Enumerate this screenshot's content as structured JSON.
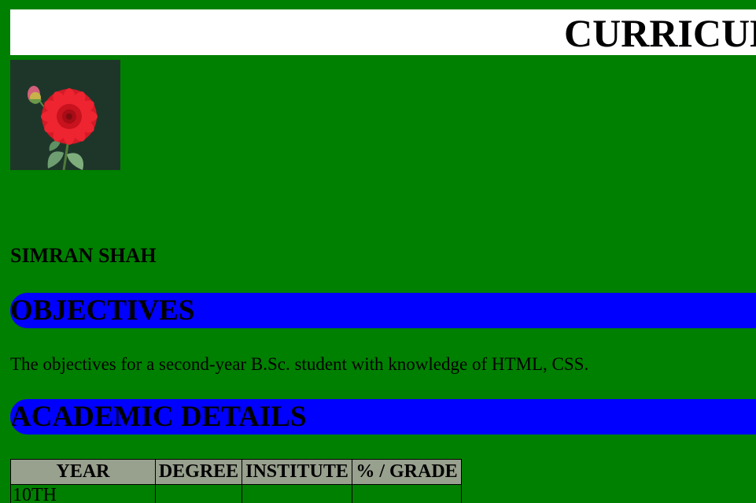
{
  "header": {
    "title": "CURRICULUM VITAE"
  },
  "profile": {
    "photo_icon": "dahlia-flower-photo",
    "name": "SIMRAN SHAH"
  },
  "sections": {
    "objectives": {
      "heading": "OBJECTIVES",
      "text": "The objectives for a second-year B.Sc. student with knowledge of HTML, CSS."
    },
    "academic": {
      "heading": "ACADEMIC DETAILS",
      "columns": [
        "YEAR",
        "DEGREE",
        "INSTITUTE",
        "% / GRADE"
      ],
      "rows": [
        [
          "10TH",
          "",
          "",
          ""
        ]
      ]
    }
  },
  "colors": {
    "page_background": "#008000",
    "title_background": "#ffffff",
    "section_bar": "#0000ff",
    "table_header": "#98a08e"
  }
}
